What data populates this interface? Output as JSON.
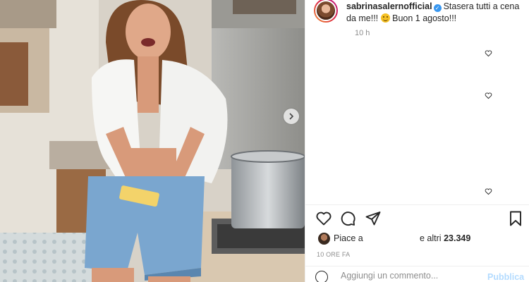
{
  "post": {
    "username": "sabrinasalernofficial",
    "caption_text": "Stasera tutti a cena da me!!! ",
    "caption_tail": " Buon 1 agosto!!!",
    "timestamp": "10 h",
    "verified": true
  },
  "likes": {
    "prefix": "Piace a",
    "suffix": "e altri",
    "count": "23.349"
  },
  "time_caps": "10 ORE FA",
  "comment": {
    "placeholder": "Aggiungi un commento...",
    "publish_label": "Pubblica"
  },
  "icons": {
    "like": "heart-icon",
    "comment": "comment-icon",
    "share": "share-icon",
    "save": "bookmark-icon",
    "emoji": "emoji-icon",
    "carousel": "chevron-right-icon"
  },
  "colors": {
    "text": "#262626",
    "muted": "#8e8e8e",
    "verified": "#3897f0",
    "publish_disabled": "#b3dbff"
  }
}
